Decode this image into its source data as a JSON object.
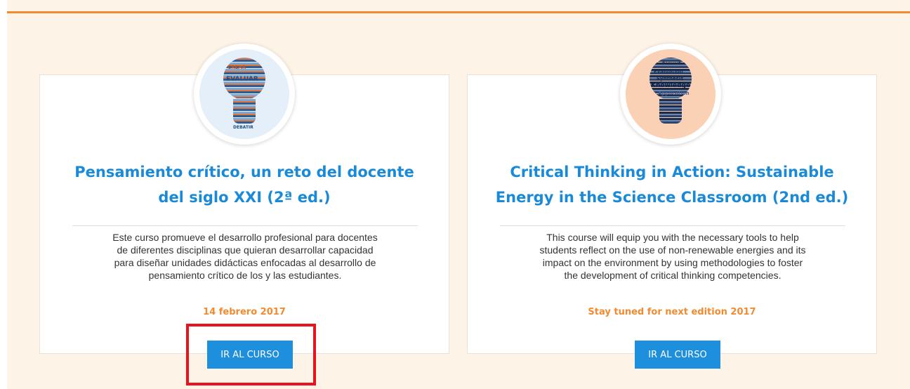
{
  "colors": {
    "accent_orange": "#f28a30",
    "title_blue": "#1a8ad8",
    "button_blue": "#1e8fdc",
    "highlight_red": "#e8141d",
    "page_background": "#fdf3e6"
  },
  "courses": [
    {
      "image_icon": "lightbulb-word-cloud-blue",
      "title_lines": [
        "Pensamiento crítico, un reto del docente",
        "del siglo XXI (2ª ed.)"
      ],
      "description_lines": [
        "Este curso promueve el desarrollo profesional para docentes",
        "de diferentes disciplinas que quieran desarrollar capacidad",
        "para diseñar unidades didácticas enfocadas al desarrollo de",
        "pensamiento crítico de los y las estudiantes."
      ],
      "date": "14 febrero 2017",
      "button_label": "IR AL CURSO",
      "image_words": [
        "EVALUAR",
        "CREAR",
        "DEBATIR"
      ]
    },
    {
      "image_icon": "lightbulb-word-cloud-orange",
      "title_lines": [
        "Critical Thinking in Action: Sustainable",
        "Energy in the Science Classroom (2nd ed.)"
      ],
      "description_lines": [
        "This course will equip you with the necessary tools to help",
        "students reflect on the use of non-renewable energies and its",
        "impact on the environment by using methodologies to foster",
        "the development of critical thinking competencies."
      ],
      "date": "Stay tuned for next edition 2017",
      "button_label": "IR AL CURSO",
      "image_words": [
        "Evaluation",
        "Synthesis",
        "Knowledge",
        "Application",
        "Convert"
      ]
    }
  ]
}
